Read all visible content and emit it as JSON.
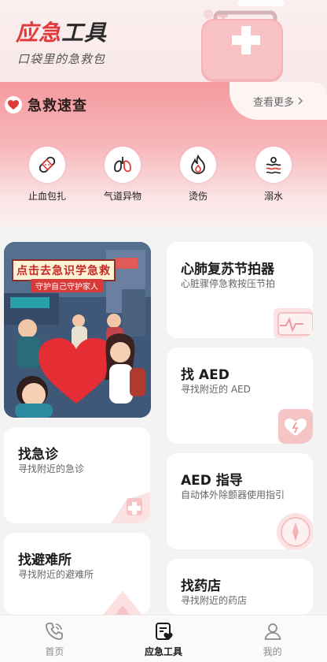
{
  "header": {
    "title_accent": "应急",
    "title_rest": "工具",
    "subtitle": "口袋里的急救包"
  },
  "first_aid": {
    "title": "急救速查",
    "more_label": "查看更多",
    "items": [
      {
        "label": "止血包扎",
        "icon": "bandage-icon"
      },
      {
        "label": "气道异物",
        "icon": "lungs-icon"
      },
      {
        "label": "烫伤",
        "icon": "flame-icon"
      },
      {
        "label": "溺水",
        "icon": "waves-icon"
      }
    ]
  },
  "banner": {
    "title": "点击去急识学急救",
    "subtitle": "守护自己守护家人"
  },
  "cards": {
    "cpr": {
      "title": "心肺复苏节拍器",
      "desc": "心脏骤停急救按压节拍"
    },
    "find_aed": {
      "title": "找 AED",
      "desc": "寻找附近的 AED"
    },
    "emergency": {
      "title": "找急诊",
      "desc": "寻找附近的急诊"
    },
    "aed_guide": {
      "title": "AED 指导",
      "desc": "自动体外除颤器使用指引"
    },
    "shelter": {
      "title": "找避难所",
      "desc": "寻找附近的避难所"
    },
    "pharmacy": {
      "title": "找药店",
      "desc": "寻找附近的药店"
    }
  },
  "nav": {
    "items": [
      {
        "label": "首页",
        "icon": "phone-icon",
        "active": false
      },
      {
        "label": "应急工具",
        "icon": "clipboard-heart-icon",
        "active": true
      },
      {
        "label": "我的",
        "icon": "person-icon",
        "active": false
      }
    ]
  },
  "colors": {
    "accent": "#e03a3a",
    "section_bg": "#f49a9e",
    "page_bg": "#f4f3f3"
  }
}
